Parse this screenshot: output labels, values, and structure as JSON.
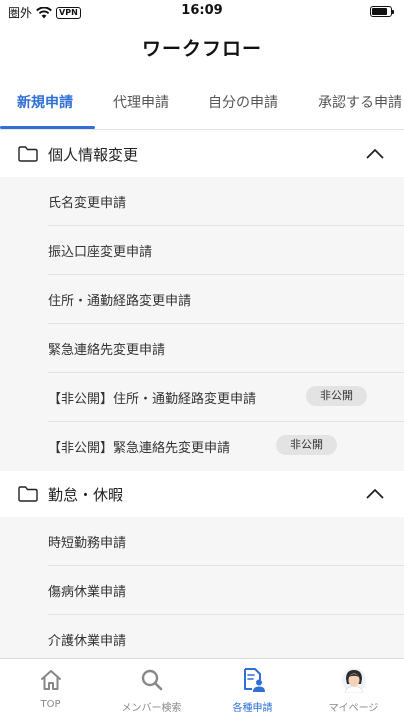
{
  "status_bar": {
    "carrier": "圏外",
    "vpn": "VPN",
    "time": "16:09"
  },
  "header": {
    "title": "ワークフロー"
  },
  "tabs": [
    {
      "label": "新規申請",
      "active": true
    },
    {
      "label": "代理申請",
      "active": false
    },
    {
      "label": "自分の申請",
      "active": false
    },
    {
      "label": "承認する申請",
      "active": false
    }
  ],
  "sections": [
    {
      "title": "個人情報変更",
      "icon": "folder-icon",
      "expanded": true,
      "items": [
        {
          "label": "氏名変更申請"
        },
        {
          "label": "振込口座変更申請"
        },
        {
          "label": "住所・通勤経路変更申請"
        },
        {
          "label": "緊急連絡先変更申請"
        },
        {
          "label": "【非公開】住所・通勤経路変更申請",
          "badge": "非公開"
        },
        {
          "label": "【非公開】緊急連絡先変更申請",
          "badge": "非公開"
        }
      ]
    },
    {
      "title": "勤怠・休暇",
      "icon": "folder-icon",
      "expanded": true,
      "items": [
        {
          "label": "時短勤務申請"
        },
        {
          "label": "傷病休業申請"
        },
        {
          "label": "介護休業申請"
        }
      ]
    }
  ],
  "bottom_nav": [
    {
      "label": "TOP",
      "icon": "home-icon",
      "active": false
    },
    {
      "label": "メンバー検索",
      "icon": "search-icon",
      "active": false
    },
    {
      "label": "各種申請",
      "icon": "application-form-icon",
      "active": true
    },
    {
      "label": "マイページ",
      "icon": "avatar-icon",
      "active": false
    }
  ],
  "colors": {
    "accent": "#2f6fd6",
    "list_background": "#f6f6f6",
    "badge_background": "#e3e3e3"
  }
}
